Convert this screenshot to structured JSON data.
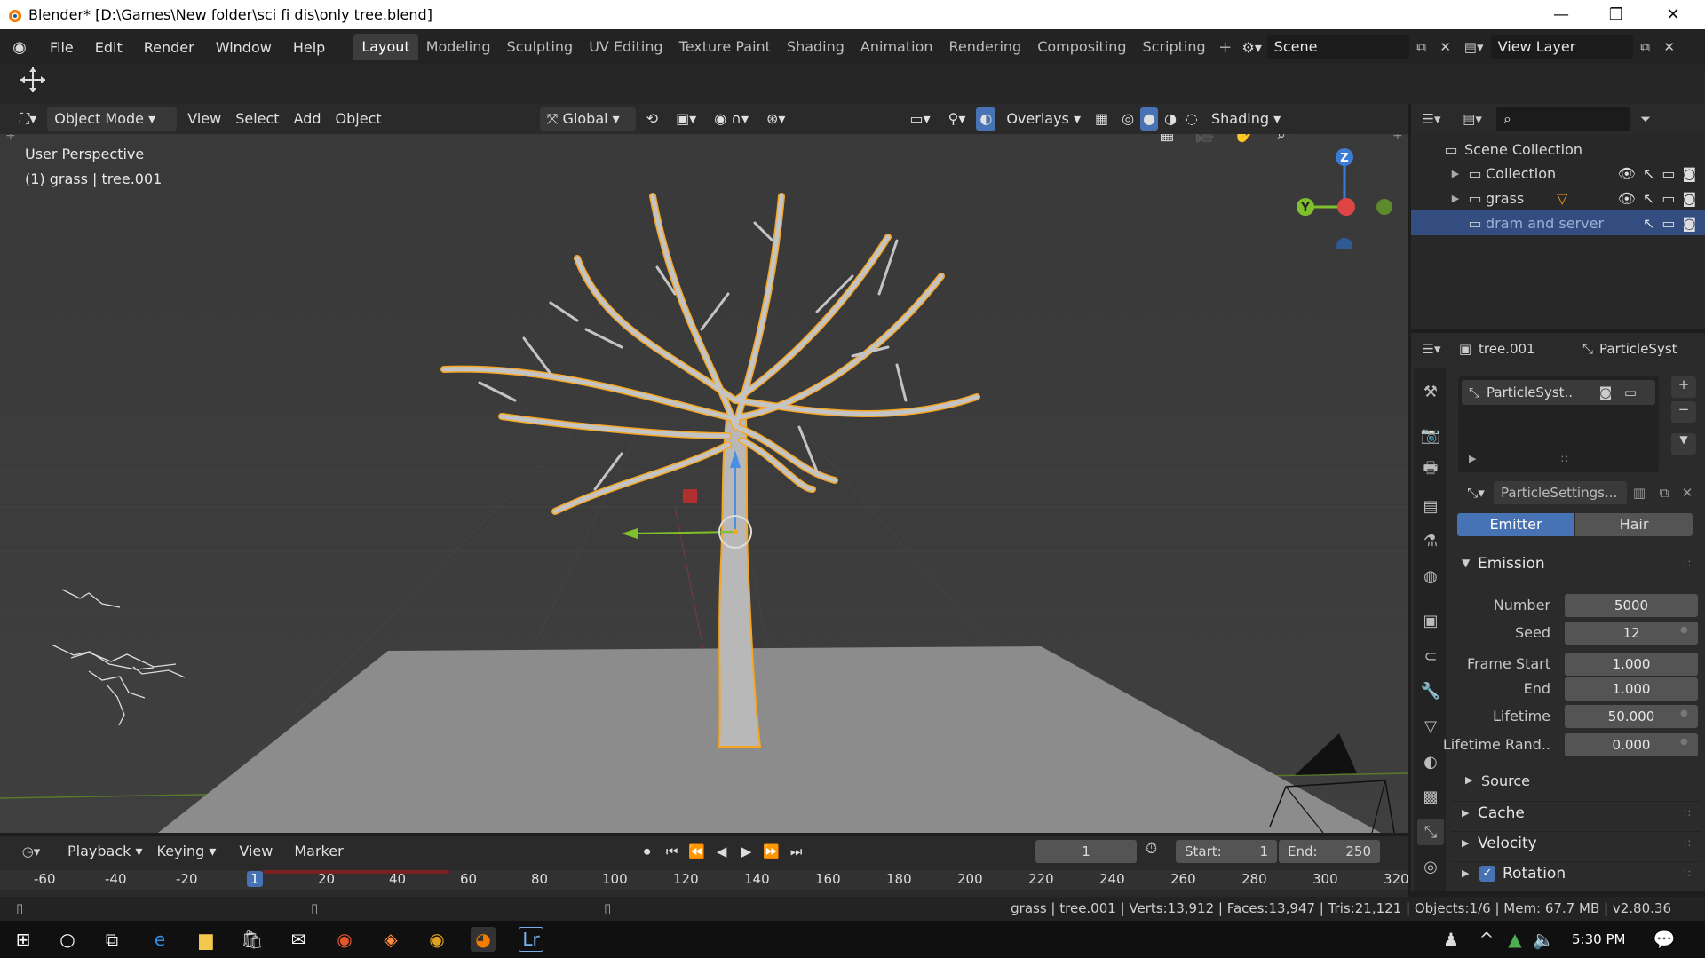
{
  "window": {
    "title": "Blender* [D:\\Games\\New folder\\sci fi dis\\only tree.blend]"
  },
  "menu": [
    "File",
    "Edit",
    "Render",
    "Window",
    "Help"
  ],
  "workspaces": [
    "Layout",
    "Modeling",
    "Sculpting",
    "UV Editing",
    "Texture Paint",
    "Shading",
    "Animation",
    "Rendering",
    "Compositing",
    "Scripting"
  ],
  "scene": {
    "label": "Scene",
    "view_layer": "View Layer"
  },
  "viewport_header": {
    "mode": "Object Mode",
    "view": "View",
    "select": "Select",
    "add": "Add",
    "object": "Object",
    "transform": "Global",
    "overlays": "Overlays",
    "shading": "Shading"
  },
  "viewport": {
    "perspective": "User Perspective",
    "selection": "(1) grass | tree.001",
    "gizmo": {
      "z": "Z",
      "y": "Y"
    }
  },
  "outliner": {
    "root": "Scene Collection",
    "items": [
      "Collection",
      "grass",
      "dram and server"
    ]
  },
  "props": {
    "object": "tree.001",
    "context": "ParticleSyst",
    "system": "ParticleSyst..",
    "settings": "ParticleSettings...",
    "emitter_tab": "Emitter",
    "hair_tab": "Hair",
    "emission_header": "Emission",
    "fields": [
      {
        "label": "Number",
        "value": "5000"
      },
      {
        "label": "Seed",
        "value": "12"
      },
      {
        "label": "Frame Start",
        "value": "1.000"
      },
      {
        "label": "End",
        "value": "1.000"
      },
      {
        "label": "Lifetime",
        "value": "50.000"
      },
      {
        "label": "Lifetime Rand..",
        "value": "0.000"
      }
    ],
    "sections": [
      "Source",
      "Cache",
      "Velocity",
      "Rotation"
    ]
  },
  "timeline": {
    "playback": "Playback",
    "keying": "Keying",
    "view": "View",
    "marker": "Marker",
    "current_frame": "1",
    "start_label": "Start:",
    "start": "1",
    "end_label": "End:",
    "end": "250",
    "ruler": [
      "-60",
      "-40",
      "-20",
      "1",
      "20",
      "40",
      "60",
      "80",
      "100",
      "120",
      "140",
      "160",
      "180",
      "200",
      "220",
      "240",
      "260",
      "280",
      "300",
      "320"
    ]
  },
  "status": "grass | tree.001 | Verts:13,912 | Faces:13,947 | Tris:21,121 | Objects:1/6 | Mem: 67.7 MB | v2.80.36",
  "taskbar": {
    "time": "5:30 PM"
  },
  "colors": {
    "accent": "#4772b3",
    "selection_orange": "#f5a623",
    "header": "#2a2a2a"
  }
}
